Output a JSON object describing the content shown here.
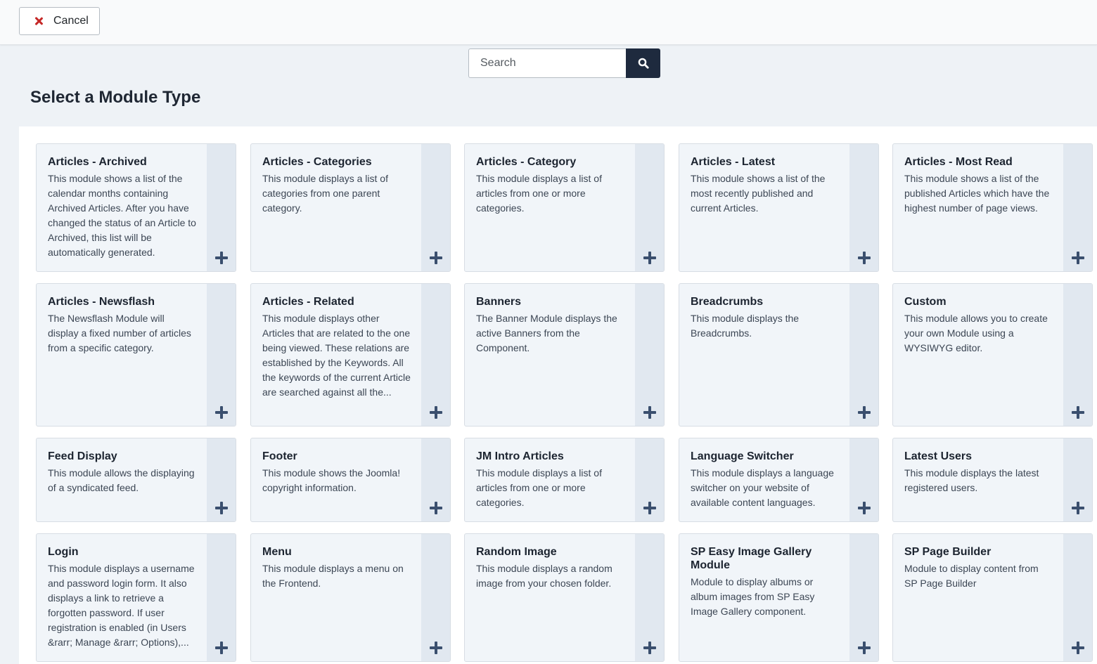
{
  "toolbar": {
    "cancel_label": "Cancel"
  },
  "search": {
    "placeholder": "Search"
  },
  "page_title": "Select a Module Type",
  "modules": [
    {
      "title": "Articles - Archived",
      "description": "This module shows a list of the calendar months containing Archived Articles. After you have changed the status of an Article to Archived, this list will be automatically generated."
    },
    {
      "title": "Articles - Categories",
      "description": "This module displays a list of categories from one parent category."
    },
    {
      "title": "Articles - Category",
      "description": "This module displays a list of articles from one or more categories."
    },
    {
      "title": "Articles - Latest",
      "description": "This module shows a list of the most recently published and current Articles."
    },
    {
      "title": "Articles - Most Read",
      "description": "This module shows a list of the published Articles which have the highest number of page views."
    },
    {
      "title": "Articles - Newsflash",
      "description": "The Newsflash Module will display a fixed number of articles from a specific category."
    },
    {
      "title": "Articles - Related",
      "description": "This module displays other Articles that are related to the one being viewed. These relations are established by the Keywords. All the keywords of the current Article are searched against all the..."
    },
    {
      "title": "Banners",
      "description": "The Banner Module displays the active Banners from the Component."
    },
    {
      "title": "Breadcrumbs",
      "description": "This module displays the Breadcrumbs."
    },
    {
      "title": "Custom",
      "description": "This module allows you to create your own Module using a WYSIWYG editor."
    },
    {
      "title": "Feed Display",
      "description": "This module allows the displaying of a syndicated feed."
    },
    {
      "title": "Footer",
      "description": "This module shows the Joomla! copyright information."
    },
    {
      "title": "JM Intro Articles",
      "description": "This module displays a list of articles from one or more categories."
    },
    {
      "title": "Language Switcher",
      "description": "This module displays a language switcher on your website of available content languages."
    },
    {
      "title": "Latest Users",
      "description": "This module displays the latest registered users."
    },
    {
      "title": "Login",
      "description": "This module displays a username and password login form. It also displays a link to retrieve a forgotten password. If user registration is enabled (in Users &rarr; Manage &rarr; Options),..."
    },
    {
      "title": "Menu",
      "description": "This module displays a menu on the Frontend."
    },
    {
      "title": "Random Image",
      "description": "This module displays a random image from your chosen folder."
    },
    {
      "title": "SP Easy Image Gallery Module",
      "description": "Module to display albums or album images from SP Easy Image Gallery component."
    },
    {
      "title": "SP Page Builder",
      "description": "Module to display content from SP Page Builder"
    }
  ]
}
